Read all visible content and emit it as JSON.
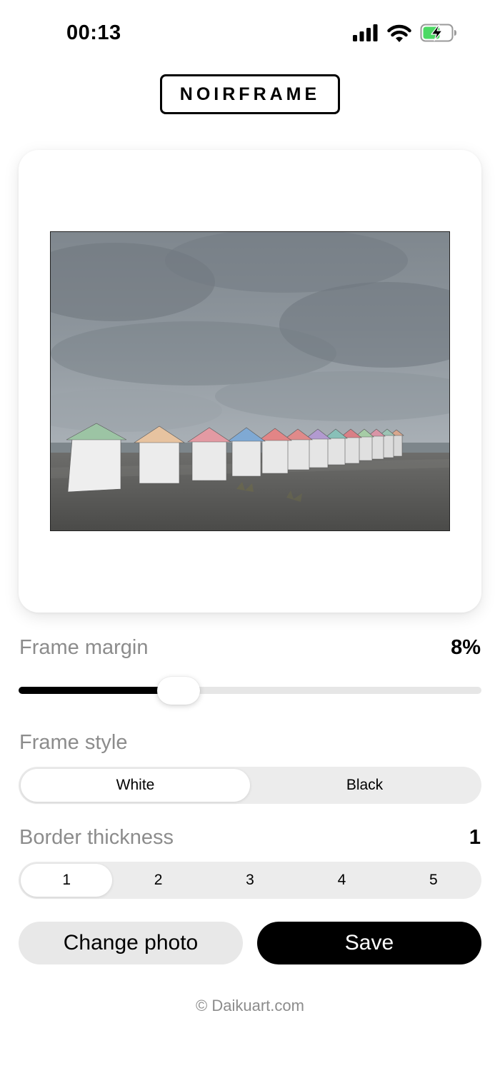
{
  "status_bar": {
    "time": "00:13",
    "icons": [
      "cellular-signal-icon",
      "wifi-icon",
      "battery-charging-icon"
    ],
    "battery_color": "#4cd964"
  },
  "app": {
    "logo_text": "NOIRFRAME"
  },
  "preview": {
    "photo_subject": "beach-huts-photo"
  },
  "controls": {
    "frame_margin": {
      "label": "Frame margin",
      "value": "8%",
      "slider_fraction": 0.33
    },
    "frame_style": {
      "label": "Frame style",
      "options": [
        "White",
        "Black"
      ],
      "selected": "White"
    },
    "border_thickness": {
      "label": "Border thickness",
      "value": "1",
      "options": [
        "1",
        "2",
        "3",
        "4",
        "5"
      ],
      "selected": "1"
    }
  },
  "actions": {
    "change_photo_label": "Change photo",
    "save_label": "Save"
  },
  "footer": {
    "copyright": "© Daikuart.com"
  },
  "colors": {
    "accent": "#000000",
    "muted_text": "#8c8c8c",
    "segment_bg": "#ececec"
  }
}
